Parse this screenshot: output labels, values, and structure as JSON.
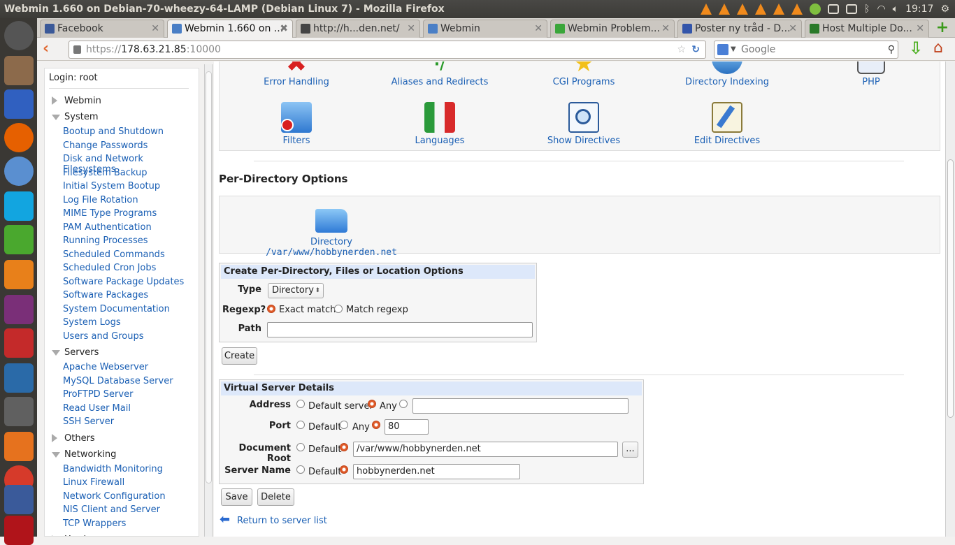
{
  "window_title": "Webmin 1.660 on Debian-70-wheezy-64-LAMP (Debian Linux 7) - Mozilla Firefox",
  "clock": "19:17",
  "tabs": [
    {
      "label": "Facebook",
      "fav": "#3b5998"
    },
    {
      "label": "Webmin 1.660 on ...",
      "fav": "#4a7fc6"
    },
    {
      "label": "http://h...den.net/",
      "fav": "#444"
    },
    {
      "label": "Webmin",
      "fav": "#4a7fc6"
    },
    {
      "label": "Webmin Problem...",
      "fav": "#3aa63a"
    },
    {
      "label": "Poster ny tråd - D...",
      "fav": "#3355aa"
    },
    {
      "label": "Host Multiple Do...",
      "fav": "#2a7a2a"
    }
  ],
  "address": {
    "scheme": "https://",
    "host": "178.63.21.85",
    "port": ":10000"
  },
  "search_placeholder": "Google",
  "sidebar": {
    "login": "Login: root",
    "categories": [
      {
        "label": "Webmin",
        "open": false
      },
      {
        "label": "System",
        "open": true,
        "items": [
          "Bootup and Shutdown",
          "Change Passwords",
          "Disk and Network Filesystems",
          "Filesystem Backup",
          "Initial System Bootup",
          "Log File Rotation",
          "MIME Type Programs",
          "PAM Authentication",
          "Running Processes",
          "Scheduled Commands",
          "Scheduled Cron Jobs",
          "Software Package Updates",
          "Software Packages",
          "System Documentation",
          "System Logs",
          "Users and Groups"
        ]
      },
      {
        "label": "Servers",
        "open": true,
        "items": [
          "Apache Webserver",
          "MySQL Database Server",
          "ProFTPD Server",
          "Read User Mail",
          "SSH Server"
        ]
      },
      {
        "label": "Others",
        "open": false
      },
      {
        "label": "Networking",
        "open": true,
        "items": [
          "Bandwidth Monitoring",
          "Linux Firewall",
          "Network Configuration",
          "NIS Client and Server",
          "TCP Wrappers"
        ]
      },
      {
        "label": "Hardware",
        "open": false
      }
    ]
  },
  "icons_row1": [
    "Error Handling",
    "Aliases and Redirects",
    "CGI Programs",
    "Directory Indexing",
    "PHP"
  ],
  "icons_row2": [
    "Filters",
    "Languages",
    "Show Directives",
    "Edit Directives"
  ],
  "per_directory": {
    "heading": "Per-Directory Options",
    "item_prefix": "Directory",
    "item_path": "/var/www/hobbynerden.net"
  },
  "create_form": {
    "header": "Create Per-Directory, Files or Location Options",
    "type_label": "Type",
    "type_value": "Directory",
    "regexp_label": "Regexp?",
    "exact_match": "Exact match",
    "match_regexp": "Match regexp",
    "path_label": "Path",
    "path_value": "",
    "create_button": "Create"
  },
  "virtual_server": {
    "header": "Virtual Server Details",
    "address_label": "Address",
    "default_server": "Default server",
    "any": "Any",
    "address_value": "",
    "port_label": "Port",
    "default": "Default",
    "port_value": "80",
    "docroot_label": "Document Root",
    "docroot_value": "/var/www/hobbynerden.net",
    "browse_label": "...",
    "servername_label": "Server Name",
    "servername_value": "hobbynerden.net",
    "save_button": "Save",
    "delete_button": "Delete"
  },
  "return_link": "Return to server list"
}
